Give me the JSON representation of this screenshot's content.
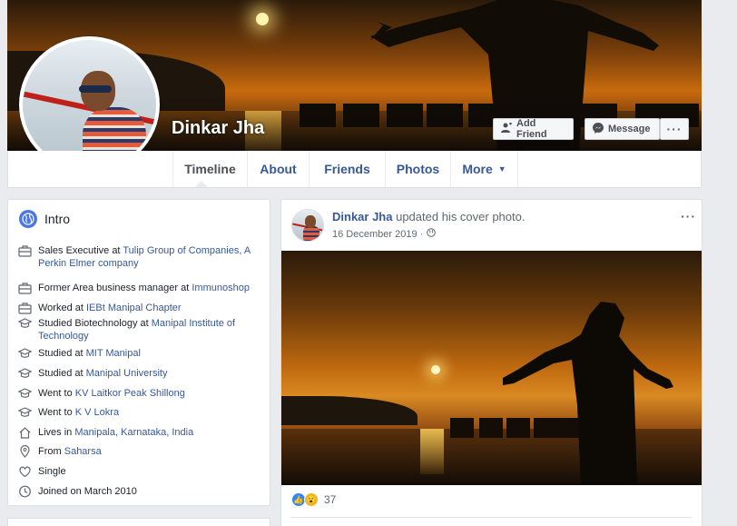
{
  "profile": {
    "name": "Dinkar Jha",
    "add_friend_label": "Add Friend",
    "message_label": "Message",
    "more_label": "···"
  },
  "nav": {
    "tabs": [
      {
        "label": "Timeline",
        "active": true
      },
      {
        "label": "About"
      },
      {
        "label": "Friends"
      },
      {
        "label": "Photos"
      },
      {
        "label": "More"
      }
    ]
  },
  "intro": {
    "title": "Intro",
    "items": [
      {
        "icon": "briefcase-icon",
        "prefix": "Sales Executive at ",
        "link": "Tulip Group of Companies, A Perkin Elmer company"
      },
      {
        "icon": "briefcase-icon",
        "prefix": "Former Area business manager at ",
        "link": "Immunoshop"
      },
      {
        "icon": "briefcase-icon",
        "prefix": "Worked at ",
        "link": "IEBt Manipal Chapter"
      },
      {
        "icon": "graduation-cap-icon",
        "prefix": "Studied Biotechnology at ",
        "link": "Manipal Institute of Technology"
      },
      {
        "icon": "graduation-cap-icon",
        "prefix": "Studied at ",
        "link": "MIT Manipal"
      },
      {
        "icon": "graduation-cap-icon",
        "prefix": "Studied at ",
        "link": "Manipal University"
      },
      {
        "icon": "graduation-cap-icon",
        "prefix": "Went to ",
        "link": "KV Laitkor Peak Shillong"
      },
      {
        "icon": "graduation-cap-icon",
        "prefix": "Went to ",
        "link": "K V Lokra"
      },
      {
        "icon": "home-icon",
        "prefix": "Lives in ",
        "link": "Manipala, Karnataka, India"
      },
      {
        "icon": "location-pin-icon",
        "prefix": "From ",
        "link": "Saharsa"
      },
      {
        "icon": "heart-icon",
        "prefix": "Single",
        "link": ""
      },
      {
        "icon": "clock-icon",
        "prefix": "Joined on March 2010",
        "link": ""
      }
    ]
  },
  "post": {
    "author": "Dinkar Jha",
    "action": " updated his cover photo.",
    "date": "16 December 2019 ·",
    "menu_label": "···",
    "reaction_count": "37"
  },
  "colors": {
    "link": "#365899",
    "background": "#e9ebee",
    "like": "#2d88ff",
    "wow": "#f7b125"
  }
}
